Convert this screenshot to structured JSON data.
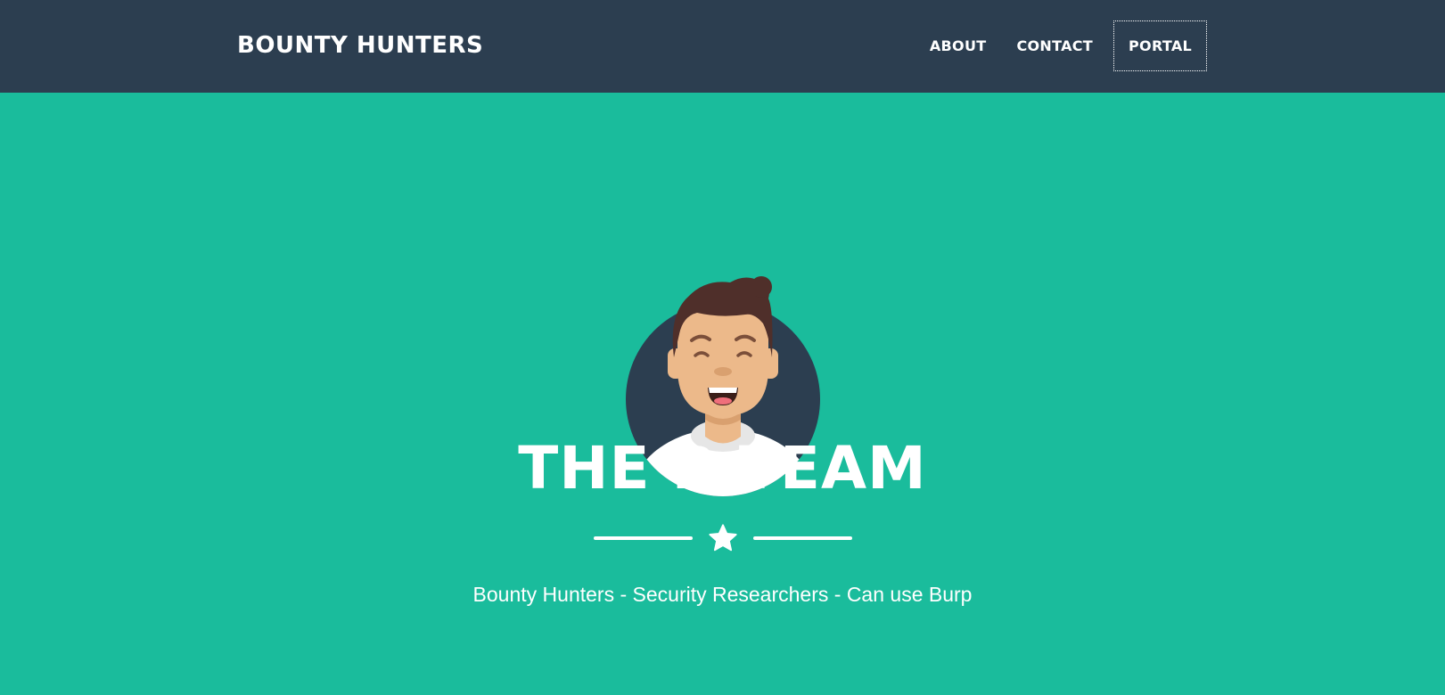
{
  "navbar": {
    "brand": "BOUNTY HUNTERS",
    "items": [
      {
        "label": "ABOUT"
      },
      {
        "label": "CONTACT"
      },
      {
        "label": "PORTAL",
        "active": true
      }
    ]
  },
  "hero": {
    "avatar_icon": "user-avatar-illustration",
    "title": "THE B TEAM",
    "divider_icon": "star-icon",
    "subtitle": "Bounty Hunters - Security Researchers - Can use Burp"
  },
  "colors": {
    "navbar_bg": "#2c3e50",
    "hero_bg": "#1abc9c",
    "text": "#ffffff"
  }
}
